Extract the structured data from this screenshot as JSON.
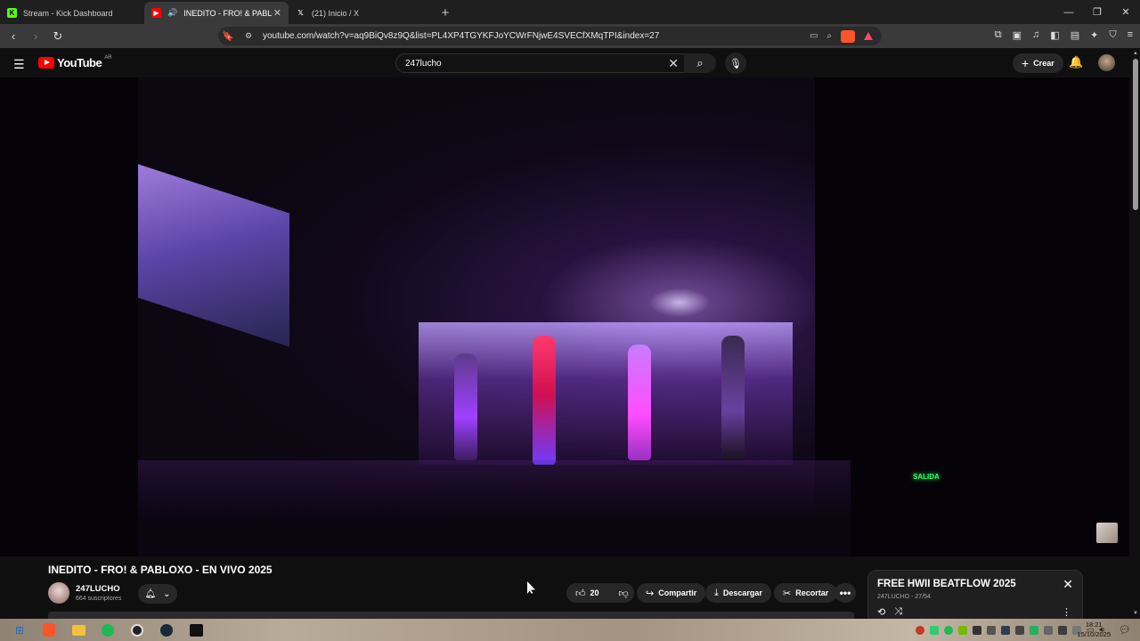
{
  "browser": {
    "tabs": [
      {
        "title": "Stream - Kick Dashboard",
        "favicon": "K",
        "active": false
      },
      {
        "title": "INEDITO - FRO! & PABLOXO -",
        "favicon": "yt",
        "active": true
      },
      {
        "title": "(21) Inicio / X",
        "favicon": "X",
        "active": false
      }
    ],
    "url": "youtube.com/watch?v=aq9BiQv8z9Q&list=PL4XP4TGYKFJoYCWrFNjwE4SVECfXMqTPI&index=27"
  },
  "youtube": {
    "logo_text": "YouTube",
    "country_code": "AR",
    "search_value": "247lucho",
    "create_label": "Crear"
  },
  "video": {
    "title": "INEDITO - FRO! & PABLOXO - EN VIVO 2025",
    "exit_sign": "SALIDA",
    "channel": {
      "name": "247LUCHO",
      "subscribers": "664 suscriptores"
    },
    "actions": {
      "likes": "20",
      "share": "Compartir",
      "download": "Descargar",
      "clip": "Recortar"
    }
  },
  "playlist": {
    "title": "FREE HWII BEATFLOW 2025",
    "subtitle": "247LUCHO - 27/54"
  },
  "taskbar": {
    "time": "18:21",
    "date": "15/10/2025"
  }
}
